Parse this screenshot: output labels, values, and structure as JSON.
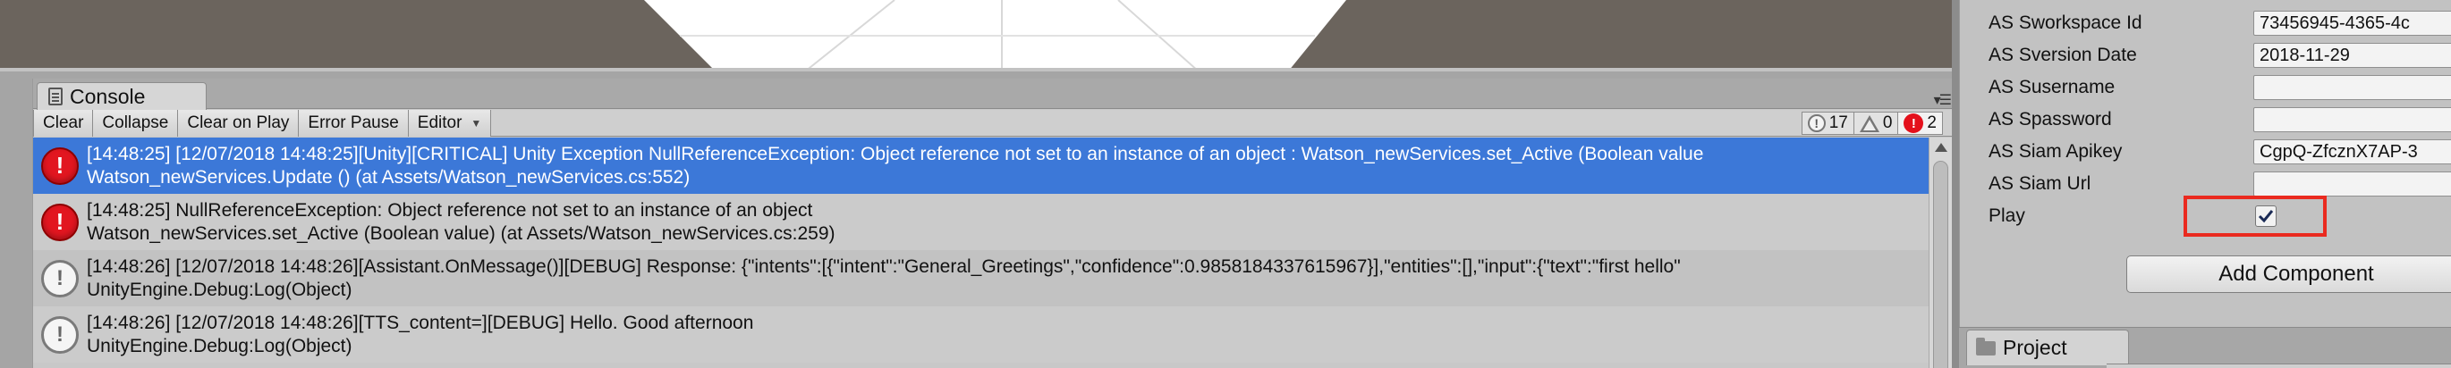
{
  "console": {
    "tab_label": "Console",
    "toolbar": {
      "clear": "Clear",
      "collapse": "Collapse",
      "clear_on_play": "Clear on Play",
      "error_pause": "Error Pause",
      "editor": "Editor"
    },
    "counts": {
      "info": "17",
      "warnings": "0",
      "errors": "2"
    },
    "entries": [
      {
        "type": "error",
        "line1": "[14:48:25] [12/07/2018 14:48:25][Unity][CRITICAL] Unity Exception NullReferenceException: Object reference not set to an instance of an object : Watson_newServices.set_Active (Boolean value",
        "line2": "Watson_newServices.Update () (at Assets/Watson_newServices.cs:552)"
      },
      {
        "type": "error",
        "line1": "[14:48:25] NullReferenceException: Object reference not set to an instance of an object",
        "line2": "Watson_newServices.set_Active (Boolean value) (at Assets/Watson_newServices.cs:259)"
      },
      {
        "type": "info",
        "line1": "[14:48:26] [12/07/2018 14:48:26][Assistant.OnMessage()][DEBUG] Response: {\"intents\":[{\"intent\":\"General_Greetings\",\"confidence\":0.9858184337615967}],\"entities\":[],\"input\":{\"text\":\"first hello\"",
        "line2": "UnityEngine.Debug:Log(Object)"
      },
      {
        "type": "info",
        "line1": "[14:48:26] [12/07/2018 14:48:26][TTS_content=][DEBUG] Hello. Good afternoon",
        "line2": "UnityEngine.Debug:Log(Object)"
      }
    ]
  },
  "inspector": {
    "properties": [
      {
        "label": "AS Sworkspace Id",
        "value": "73456945-4365-4c"
      },
      {
        "label": "AS Sversion Date",
        "value": "2018-11-29"
      },
      {
        "label": "AS Susername",
        "value": ""
      },
      {
        "label": "AS Spassword",
        "value": ""
      },
      {
        "label": "AS Siam Apikey",
        "value": "CgpQ-ZfcznX7AP-3"
      },
      {
        "label": "AS Siam Url",
        "value": ""
      }
    ],
    "play_label": "Play",
    "play_checked": true,
    "add_component": "Add Component",
    "highlight_color": "#ea2a1f"
  },
  "project": {
    "tab_label": "Project"
  },
  "colors": {
    "selection": "#3c78d8",
    "error_red": "#e21620"
  }
}
